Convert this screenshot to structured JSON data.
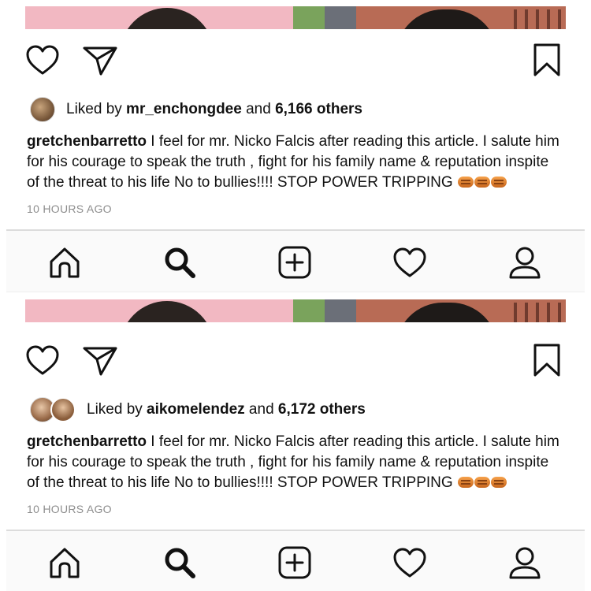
{
  "posts": [
    {
      "liked_by_user": "mr_enchongdee",
      "liked_prefix": "Liked by ",
      "liked_and": " and ",
      "liked_count": "6,166 others",
      "caption_user": "gretchenbarretto",
      "caption_text": " I feel for mr. Nicko Falcis after reading this article. I salute him for his courage to speak the truth , fight for his family name & reputation inspite of the threat to his life No to bullies!!!! STOP POWER TRIPPING ",
      "timestamp": "10 HOURS AGO"
    },
    {
      "liked_by_user": "aikomelendez",
      "liked_prefix": "Liked by ",
      "liked_and": " and ",
      "liked_count": "6,172 others",
      "caption_user": "gretchenbarretto",
      "caption_text": " I feel for mr. Nicko Falcis after reading this article. I salute him for his courage to speak the truth , fight for his family name & reputation inspite of the threat to his life No to bullies!!!! STOP POWER TRIPPING ",
      "timestamp": "10 HOURS AGO"
    }
  ],
  "icons": {
    "like": "heart-icon",
    "share": "paper-plane-icon",
    "save": "bookmark-icon",
    "emoji": "oncoming-fist-emoji",
    "nav": [
      "home-icon",
      "search-icon",
      "add-post-icon",
      "activity-heart-icon",
      "profile-icon"
    ]
  },
  "colors": {
    "text": "#111111",
    "muted": "#8e8e8e",
    "nav_background": "#fafafa"
  }
}
